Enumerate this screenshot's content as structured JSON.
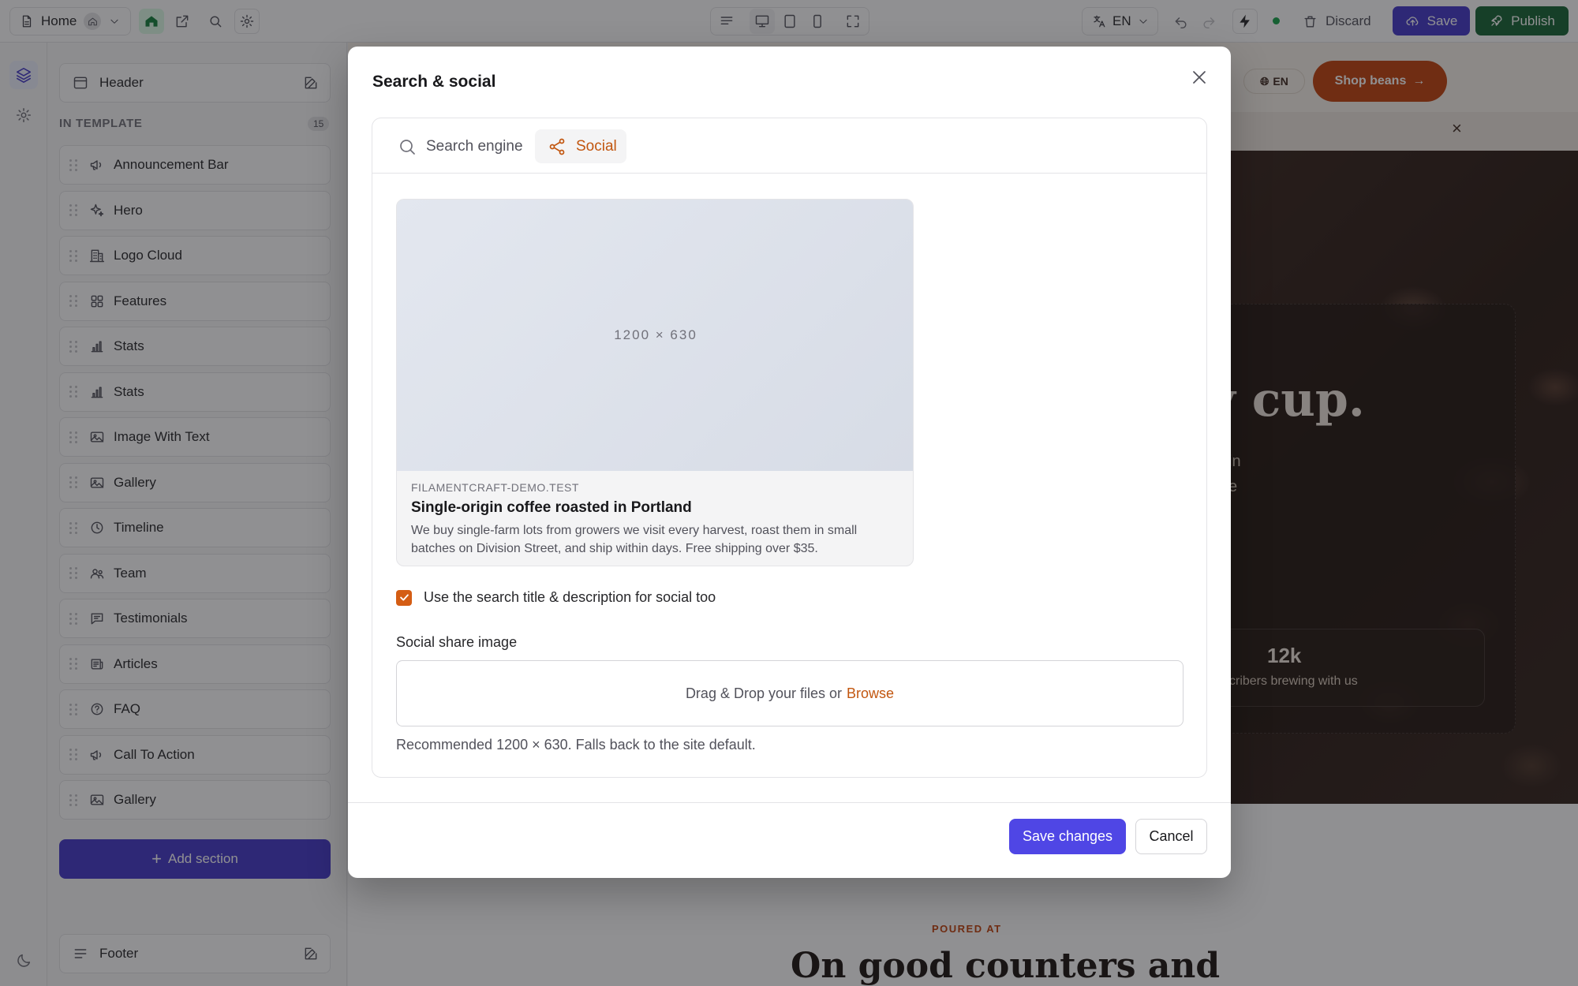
{
  "toolbar": {
    "page_label": "Home",
    "language": "EN",
    "discard_label": "Discard",
    "save_label": "Save",
    "publish_label": "Publish"
  },
  "sidebar": {
    "header_label": "Header",
    "template_heading": "IN TEMPLATE",
    "template_count": "15",
    "items": [
      {
        "label": "Announcement Bar",
        "icon": "megaphone-icon"
      },
      {
        "label": "Hero",
        "icon": "sparkles-icon"
      },
      {
        "label": "Logo Cloud",
        "icon": "building-icon"
      },
      {
        "label": "Features",
        "icon": "grid-icon"
      },
      {
        "label": "Stats",
        "icon": "bar-chart-icon"
      },
      {
        "label": "Stats",
        "icon": "bar-chart-icon"
      },
      {
        "label": "Image With Text",
        "icon": "image-icon"
      },
      {
        "label": "Gallery",
        "icon": "image-icon"
      },
      {
        "label": "Timeline",
        "icon": "clock-icon"
      },
      {
        "label": "Team",
        "icon": "users-icon"
      },
      {
        "label": "Testimonials",
        "icon": "chat-icon"
      },
      {
        "label": "Articles",
        "icon": "newspaper-icon"
      },
      {
        "label": "FAQ",
        "icon": "question-icon"
      },
      {
        "label": "Call To Action",
        "icon": "megaphone-icon"
      },
      {
        "label": "Gallery",
        "icon": "image-icon"
      }
    ],
    "add_section_label": "Add section",
    "footer_label": "Footer"
  },
  "canvas": {
    "lang_label": "EN",
    "shop_button_label": "Shop beans",
    "hero_headline_fragment": "y cup.",
    "hero_line1_fragment": "in",
    "hero_line2_fragment": "e",
    "stat_value": "12k",
    "stat_label_fragment": "cribers brewing with us",
    "poured_at_label": "POURED AT",
    "section_heading": "On good counters and"
  },
  "modal": {
    "title": "Search & social",
    "tabs": [
      {
        "label": "Search engine",
        "icon": "search-icon"
      },
      {
        "label": "Social",
        "icon": "share-icon"
      }
    ],
    "preview": {
      "image_size": "1200 × 630",
      "domain": "FILAMENTCRAFT-DEMO.TEST",
      "title": "Single-origin coffee roasted in Portland",
      "description": "We buy single-farm lots from growers we visit every harvest, roast them in small batches on Division Street, and ship within days. Free shipping over $35."
    },
    "checkbox_label": "Use the search title & description for social too",
    "checkbox_checked": true,
    "share_image_label": "Social share image",
    "dropzone_text": "Drag & Drop your files or",
    "dropzone_browse": "Browse",
    "helper_text": "Recommended 1200 × 630. Falls back to the site default.",
    "save_button": "Save changes",
    "cancel_button": "Cancel"
  },
  "colors": {
    "primary": "#4f46e5",
    "publish": "#166534",
    "accent": "#c2560f",
    "hero_bg": "#2c1d16"
  }
}
